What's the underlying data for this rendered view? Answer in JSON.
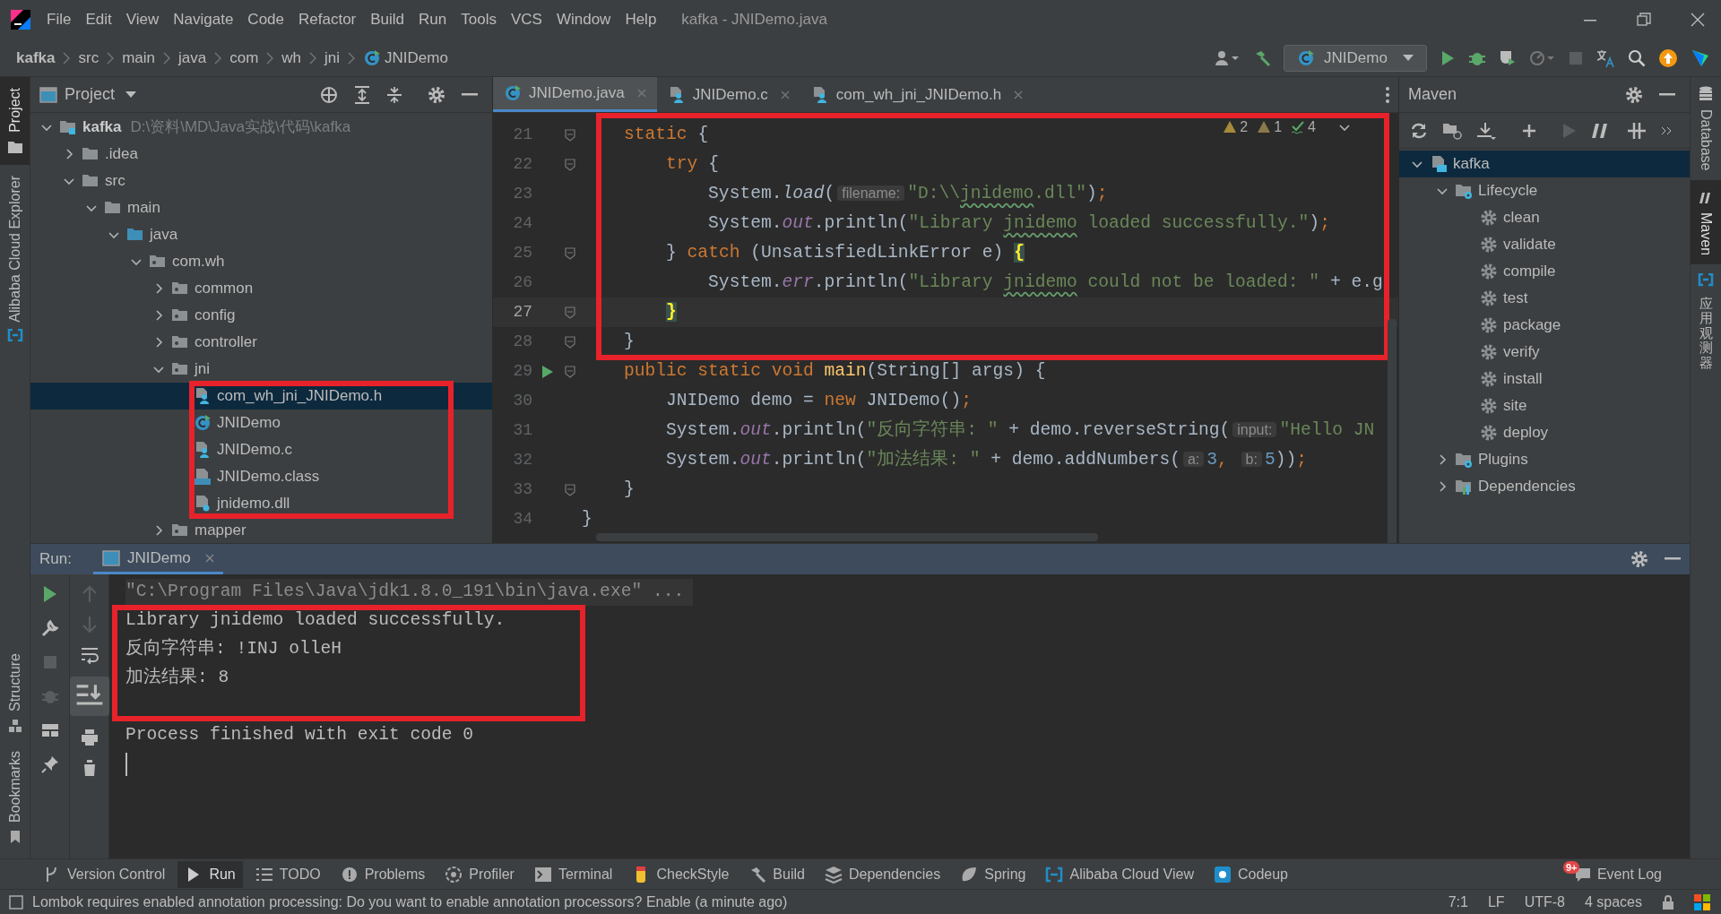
{
  "window": {
    "title": "kafka - JNIDemo.java"
  },
  "menu_bar": [
    "File",
    "Edit",
    "View",
    "Navigate",
    "Code",
    "Refactor",
    "Build",
    "Run",
    "Tools",
    "VCS",
    "Window",
    "Help"
  ],
  "breadcrumbs": [
    {
      "label": "kafka",
      "kind": "project"
    },
    {
      "label": "src",
      "kind": "folder"
    },
    {
      "label": "main",
      "kind": "folder"
    },
    {
      "label": "java",
      "kind": "folder"
    },
    {
      "label": "com",
      "kind": "folder"
    },
    {
      "label": "wh",
      "kind": "folder"
    },
    {
      "label": "jni",
      "kind": "folder"
    },
    {
      "label": "JNIDemo",
      "kind": "class"
    }
  ],
  "toolbar": {
    "run_configuration": "JNIDemo"
  },
  "left_stripe": [
    {
      "label": "Project",
      "selected": true,
      "kind": "project"
    },
    {
      "label": "Alibaba Cloud Explorer",
      "selected": false,
      "kind": "cloud"
    }
  ],
  "left_stripe_bottom": [
    {
      "label": "Structure",
      "selected": false
    },
    {
      "label": "Bookmarks",
      "selected": false
    }
  ],
  "right_stripe": [
    {
      "label": "Database",
      "selected": false,
      "kind": "database"
    },
    {
      "label": "Maven",
      "selected": true,
      "kind": "maven"
    },
    {
      "label": "应用观测器",
      "selected": false,
      "kind": "cloud"
    }
  ],
  "project_panel": {
    "title": "Project",
    "tree": [
      {
        "label": "kafka",
        "path": "D:\\资料\\MD\\Java实战\\代码\\kafka",
        "kind": "module",
        "expanded": true,
        "selected": false,
        "framed": false,
        "children": [
          {
            "label": ".idea",
            "kind": "folder",
            "expanded": false,
            "selected": false,
            "framed": false
          },
          {
            "label": "src",
            "kind": "folder",
            "expanded": true,
            "selected": false,
            "framed": false,
            "children": [
              {
                "label": "main",
                "kind": "folder",
                "expanded": true,
                "selected": false,
                "framed": false,
                "children": [
                  {
                    "label": "java",
                    "kind": "source_root",
                    "expanded": true,
                    "selected": false,
                    "framed": false,
                    "children": [
                      {
                        "label": "com.wh",
                        "kind": "package",
                        "expanded": true,
                        "selected": false,
                        "framed": false,
                        "children": [
                          {
                            "label": "common",
                            "kind": "package",
                            "expanded": false,
                            "selected": false,
                            "framed": false
                          },
                          {
                            "label": "config",
                            "kind": "package",
                            "expanded": false,
                            "selected": false,
                            "framed": false
                          },
                          {
                            "label": "controller",
                            "kind": "package",
                            "expanded": false,
                            "selected": false,
                            "framed": false
                          },
                          {
                            "label": "jni",
                            "kind": "package",
                            "expanded": true,
                            "selected": false,
                            "framed": false,
                            "children": [
                              {
                                "label": "com_wh_jni_JNIDemo.h",
                                "kind": "native_file",
                                "selected": true,
                                "framed": true
                              },
                              {
                                "label": "JNIDemo",
                                "kind": "class",
                                "selected": false,
                                "framed": true
                              },
                              {
                                "label": "JNIDemo.c",
                                "kind": "native_file",
                                "selected": false,
                                "framed": true
                              },
                              {
                                "label": "JNIDemo.class",
                                "kind": "class_file",
                                "selected": false,
                                "framed": true
                              },
                              {
                                "label": "jnidemo.dll",
                                "kind": "dll",
                                "selected": false,
                                "framed": true
                              }
                            ]
                          },
                          {
                            "label": "mapper",
                            "kind": "package",
                            "expanded": false,
                            "selected": false,
                            "framed": false
                          }
                        ]
                      }
                    ]
                  }
                ]
              }
            ]
          }
        ]
      }
    ]
  },
  "editor": {
    "tabs": [
      {
        "label": "JNIDemo.java",
        "kind": "class",
        "selected": true
      },
      {
        "label": "JNIDemo.c",
        "kind": "native_file",
        "selected": false
      },
      {
        "label": "com_wh_jni_JNIDemo.h",
        "kind": "native_file",
        "selected": false
      }
    ],
    "inspections": [
      {
        "count": "2",
        "kind": "warning"
      },
      {
        "count": "1",
        "kind": "weak_warning"
      },
      {
        "count": "4",
        "kind": "typo"
      }
    ],
    "lines": [
      {
        "number": "21",
        "current": false,
        "fold": true,
        "run_marker": false,
        "framed": true,
        "tokens": [
          {
            "kind": "keyword",
            "text": "    static"
          },
          {
            "kind": "plain",
            "text": " {"
          }
        ]
      },
      {
        "number": "22",
        "current": false,
        "fold": true,
        "run_marker": false,
        "framed": true,
        "tokens": [
          {
            "kind": "keyword",
            "text": "        try"
          },
          {
            "kind": "plain",
            "text": " {"
          }
        ]
      },
      {
        "number": "23",
        "current": false,
        "fold": false,
        "run_marker": false,
        "framed": true,
        "tokens": [
          {
            "kind": "plain",
            "text": "            System."
          },
          {
            "kind": "static_method",
            "text": "load"
          },
          {
            "kind": "plain",
            "text": "("
          },
          {
            "kind": "hint",
            "text": "filename:"
          },
          {
            "kind": "string",
            "text": "\"D:\\\\"
          },
          {
            "kind": "typo",
            "text": "jnidemo"
          },
          {
            "kind": "string",
            "text": ".dll\""
          },
          {
            "kind": "plain",
            "text": ")"
          },
          {
            "kind": "punct",
            "text": ";"
          }
        ]
      },
      {
        "number": "24",
        "current": false,
        "fold": false,
        "run_marker": false,
        "framed": true,
        "tokens": [
          {
            "kind": "plain",
            "text": "            System."
          },
          {
            "kind": "field",
            "text": "out"
          },
          {
            "kind": "plain",
            "text": ".println("
          },
          {
            "kind": "string",
            "text": "\"Library "
          },
          {
            "kind": "typo",
            "text": "jnidemo"
          },
          {
            "kind": "string",
            "text": " loaded successfully.\""
          },
          {
            "kind": "plain",
            "text": ")"
          },
          {
            "kind": "punct",
            "text": ";"
          }
        ]
      },
      {
        "number": "25",
        "current": false,
        "fold": true,
        "run_marker": false,
        "framed": true,
        "tokens": [
          {
            "kind": "plain",
            "text": "        } "
          },
          {
            "kind": "keyword",
            "text": "catch"
          },
          {
            "kind": "plain",
            "text": " (UnsatisfiedLinkError e) "
          },
          {
            "kind": "brace",
            "text": "{"
          }
        ]
      },
      {
        "number": "26",
        "current": false,
        "fold": false,
        "run_marker": false,
        "framed": true,
        "tokens": [
          {
            "kind": "plain",
            "text": "            System."
          },
          {
            "kind": "field",
            "text": "err"
          },
          {
            "kind": "plain",
            "text": ".println("
          },
          {
            "kind": "string",
            "text": "\"Library "
          },
          {
            "kind": "typo",
            "text": "jnidemo"
          },
          {
            "kind": "string",
            "text": " could not be loaded: \""
          },
          {
            "kind": "plain",
            "text": " + e.g"
          }
        ]
      },
      {
        "number": "27",
        "current": true,
        "fold": true,
        "run_marker": false,
        "framed": true,
        "tokens": [
          {
            "kind": "brace",
            "text": "        }"
          }
        ]
      },
      {
        "number": "28",
        "current": false,
        "fold": true,
        "run_marker": false,
        "framed": true,
        "tokens": [
          {
            "kind": "plain",
            "text": "    }"
          }
        ]
      },
      {
        "number": "29",
        "current": false,
        "fold": true,
        "run_marker": true,
        "framed": false,
        "tokens": [
          {
            "kind": "keyword",
            "text": "    public static void"
          },
          {
            "kind": "method",
            "text": " main"
          },
          {
            "kind": "plain",
            "text": "(String[] args) {"
          }
        ]
      },
      {
        "number": "30",
        "current": false,
        "fold": false,
        "run_marker": false,
        "framed": false,
        "tokens": [
          {
            "kind": "plain",
            "text": "        JNIDemo demo = "
          },
          {
            "kind": "keyword",
            "text": "new"
          },
          {
            "kind": "plain",
            "text": " JNIDemo()"
          },
          {
            "kind": "punct",
            "text": ";"
          }
        ]
      },
      {
        "number": "31",
        "current": false,
        "fold": false,
        "run_marker": false,
        "framed": false,
        "tokens": [
          {
            "kind": "plain",
            "text": "        System."
          },
          {
            "kind": "field",
            "text": "out"
          },
          {
            "kind": "plain",
            "text": ".println("
          },
          {
            "kind": "string",
            "text": "\"反向字符串: \""
          },
          {
            "kind": "plain",
            "text": " + demo.reverseString("
          },
          {
            "kind": "hint",
            "text": "input:"
          },
          {
            "kind": "string",
            "text": "\"Hello JN"
          }
        ]
      },
      {
        "number": "32",
        "current": false,
        "fold": false,
        "run_marker": false,
        "framed": false,
        "tokens": [
          {
            "kind": "plain",
            "text": "        System."
          },
          {
            "kind": "field",
            "text": "out"
          },
          {
            "kind": "plain",
            "text": ".println("
          },
          {
            "kind": "string",
            "text": "\"加法结果: \""
          },
          {
            "kind": "plain",
            "text": " + demo.addNumbers("
          },
          {
            "kind": "hint",
            "text": "a:"
          },
          {
            "kind": "number",
            "text": "3"
          },
          {
            "kind": "punct",
            "text": ","
          },
          {
            "kind": "hint",
            "text": " b:"
          },
          {
            "kind": "number",
            "text": "5"
          },
          {
            "kind": "plain",
            "text": "))"
          },
          {
            "kind": "punct",
            "text": ";"
          }
        ]
      },
      {
        "number": "33",
        "current": false,
        "fold": true,
        "run_marker": false,
        "framed": false,
        "tokens": [
          {
            "kind": "plain",
            "text": "    }"
          }
        ]
      },
      {
        "number": "34",
        "current": false,
        "fold": false,
        "run_marker": false,
        "framed": false,
        "tokens": [
          {
            "kind": "plain",
            "text": "}"
          }
        ]
      }
    ]
  },
  "maven_panel": {
    "title": "Maven",
    "tree": [
      {
        "label": "kafka",
        "kind": "maven_project",
        "expanded": true,
        "selected": true,
        "children": [
          {
            "label": "Lifecycle",
            "kind": "lifecycle",
            "expanded": true,
            "selected": false,
            "children": [
              {
                "label": "clean",
                "kind": "goal",
                "selected": false
              },
              {
                "label": "validate",
                "kind": "goal",
                "selected": false
              },
              {
                "label": "compile",
                "kind": "goal",
                "selected": false
              },
              {
                "label": "test",
                "kind": "goal",
                "selected": false
              },
              {
                "label": "package",
                "kind": "goal",
                "selected": false
              },
              {
                "label": "verify",
                "kind": "goal",
                "selected": false
              },
              {
                "label": "install",
                "kind": "goal",
                "selected": false
              },
              {
                "label": "site",
                "kind": "goal",
                "selected": false
              },
              {
                "label": "deploy",
                "kind": "goal",
                "selected": false
              }
            ]
          },
          {
            "label": "Plugins",
            "kind": "lifecycle",
            "expanded": false,
            "selected": false
          },
          {
            "label": "Dependencies",
            "kind": "dependencies",
            "expanded": false,
            "selected": false
          }
        ]
      }
    ]
  },
  "run_panel": {
    "title": "Run:",
    "tab": "JNIDemo",
    "console": [
      {
        "text": "\"C:\\Program Files\\Java\\jdk1.8.0_191\\bin\\java.exe\" ...",
        "kind": "command",
        "framed": false
      },
      {
        "text": "Library jnidemo loaded successfully.",
        "kind": "output",
        "framed": true
      },
      {
        "text": "反向字符串: !INJ olleH",
        "kind": "output",
        "framed": true
      },
      {
        "text": "加法结果: 8",
        "kind": "output",
        "framed": true
      },
      {
        "text": "Process finished with exit code 0",
        "kind": "output",
        "framed": false
      }
    ]
  },
  "tool_windows": [
    {
      "label": "Version Control",
      "kind": "vcs",
      "selected": false
    },
    {
      "label": "Run",
      "kind": "run",
      "selected": true
    },
    {
      "label": "TODO",
      "kind": "todo",
      "selected": false
    },
    {
      "label": "Problems",
      "kind": "problems",
      "selected": false
    },
    {
      "label": "Profiler",
      "kind": "profiler",
      "selected": false
    },
    {
      "label": "Terminal",
      "kind": "terminal",
      "selected": false
    },
    {
      "label": "CheckStyle",
      "kind": "checkstyle",
      "selected": false
    },
    {
      "label": "Build",
      "kind": "build",
      "selected": false
    },
    {
      "label": "Dependencies",
      "kind": "dependencies",
      "selected": false
    },
    {
      "label": "Spring",
      "kind": "spring",
      "selected": false
    },
    {
      "label": "Alibaba Cloud View",
      "kind": "cloud",
      "selected": false
    },
    {
      "label": "Codeup",
      "kind": "codeup",
      "selected": false
    }
  ],
  "event_log": {
    "label": "Event Log",
    "badge": "9+"
  },
  "status_bar": {
    "message": "Lombok requires enabled annotation processing: Do you want to enable annotation processors? Enable (a minute ago)",
    "items": [
      "7:1",
      "LF",
      "UTF-8",
      "4 spaces"
    ]
  }
}
